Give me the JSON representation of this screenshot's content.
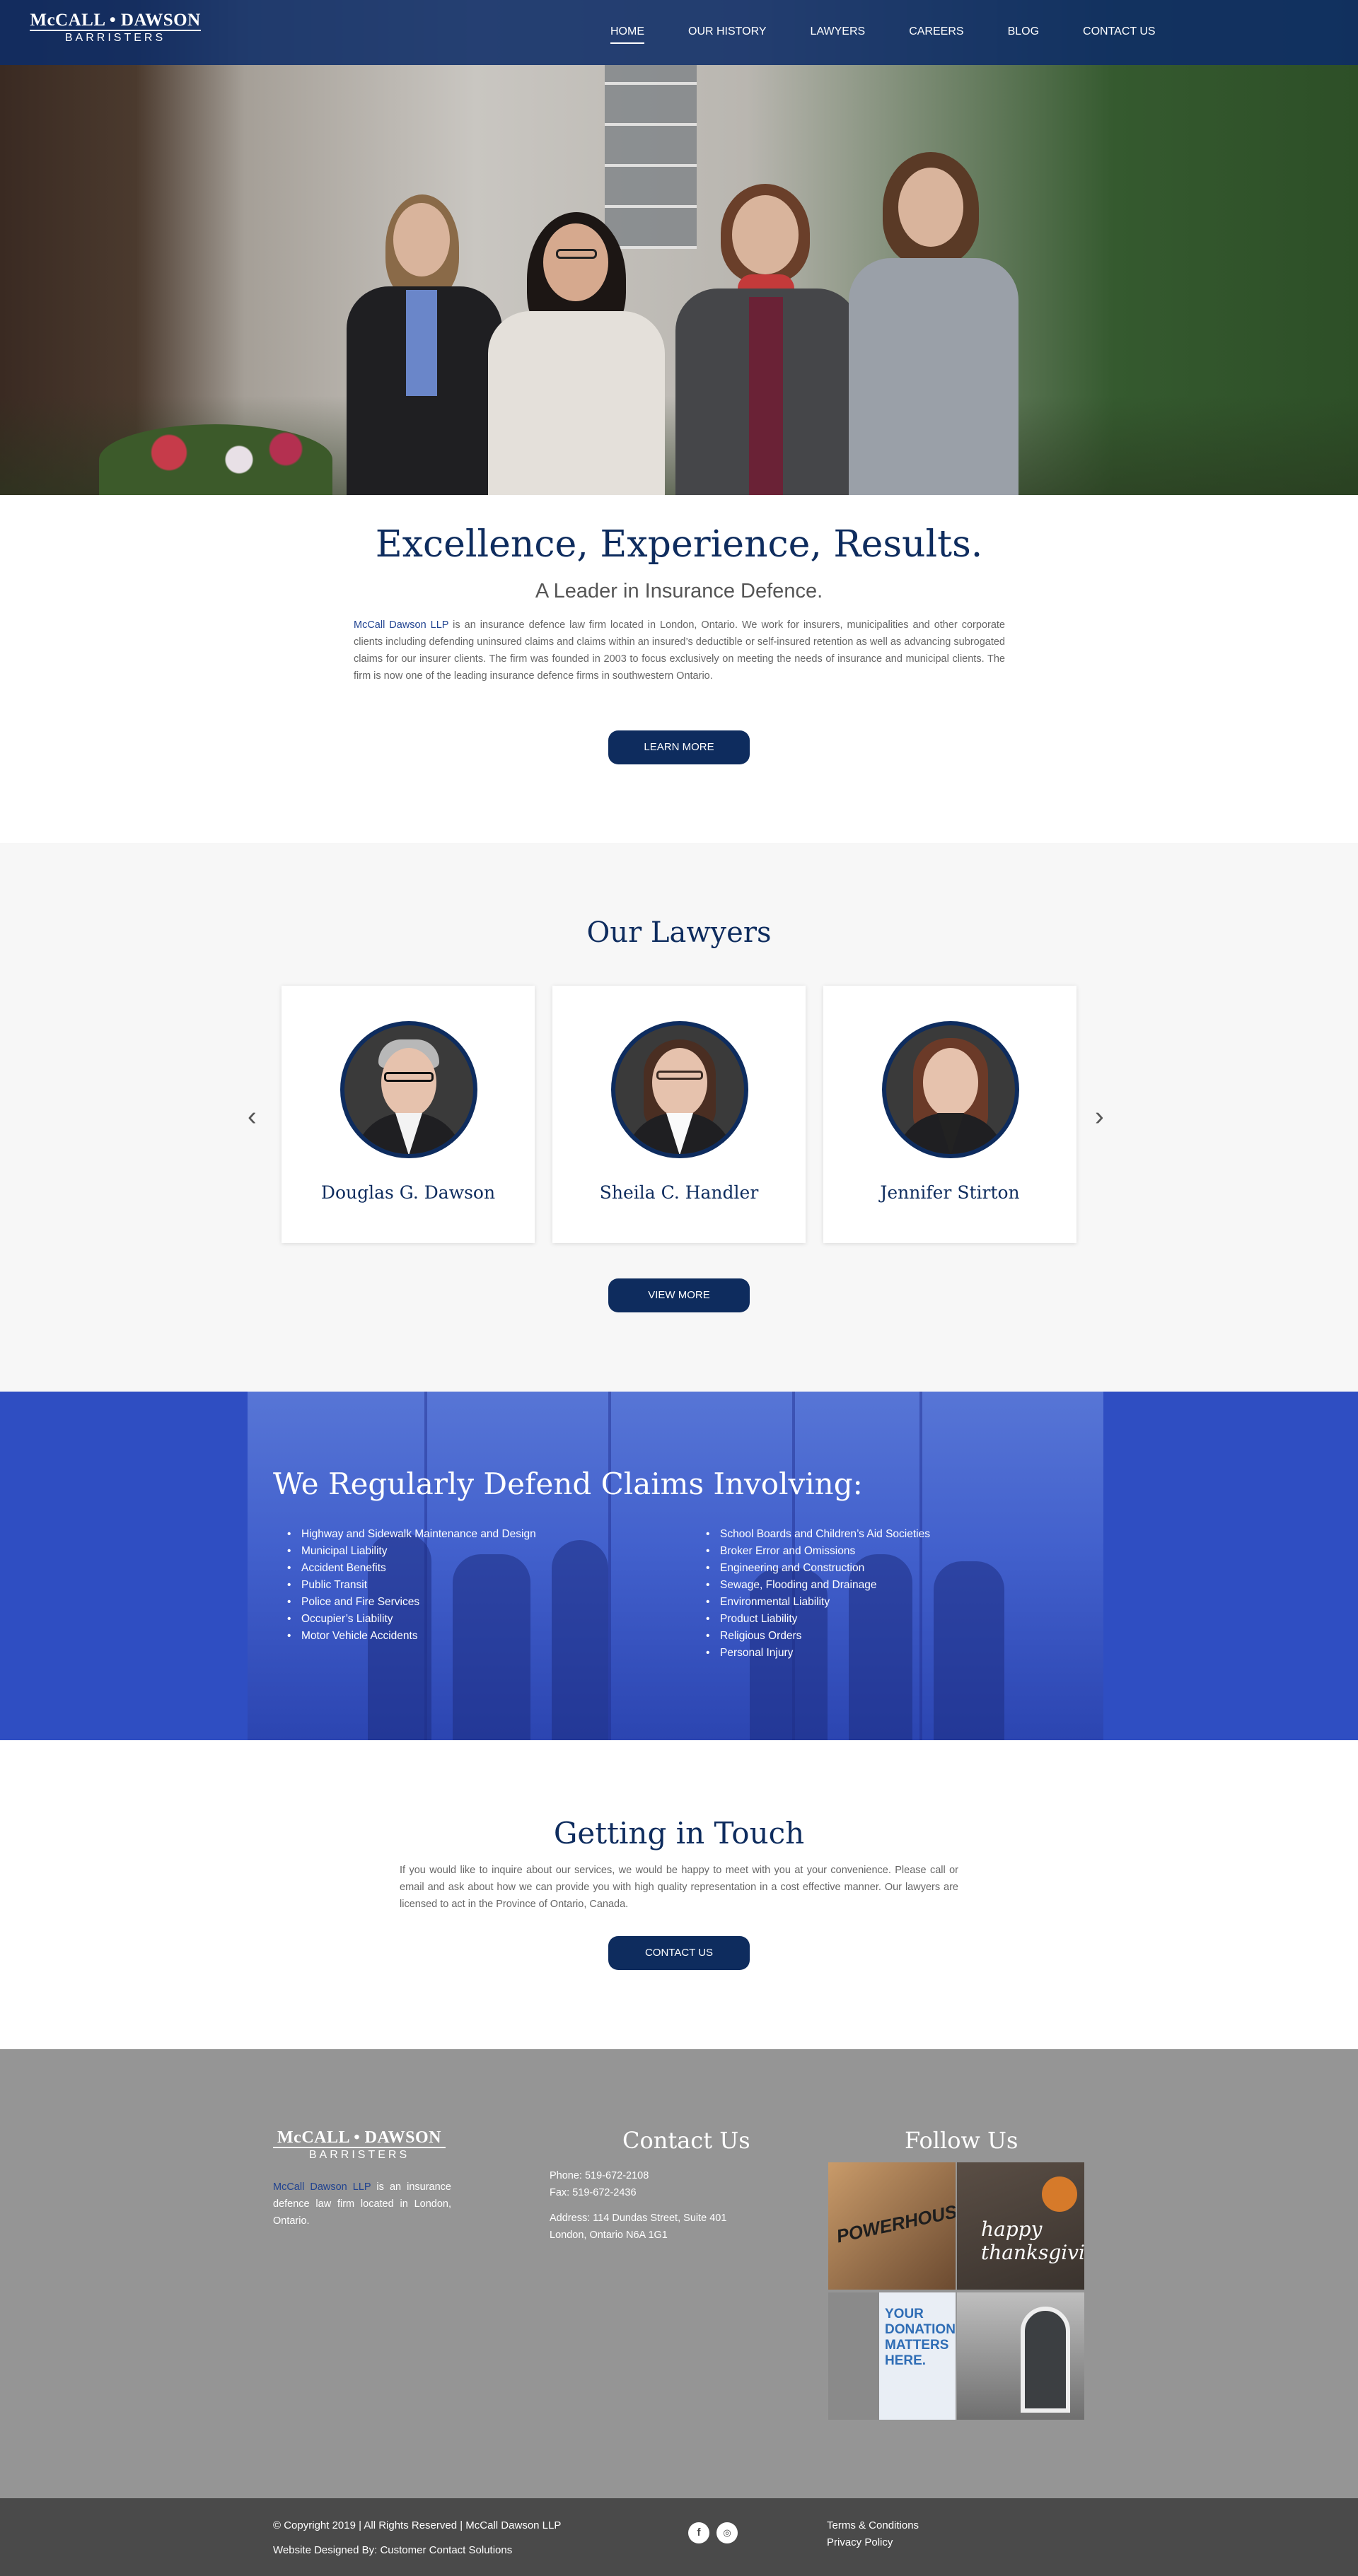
{
  "brand": {
    "name": "McCALL • DAWSON",
    "llp": "LLP",
    "tagline": "BARRISTERS"
  },
  "nav": {
    "items": [
      "HOME",
      "OUR HISTORY",
      "LAWYERS",
      "CAREERS",
      "BLOG",
      "CONTACT US"
    ],
    "active": "HOME"
  },
  "intro": {
    "title": "Excellence, Experience, Results.",
    "subtitle": "A Leader in Insurance Defence.",
    "firm_name": "McCall Dawson LLP",
    "body": " is an insurance defence law firm located in London, Ontario. We work for insurers, municipalities and other corporate clients including defending uninsured claims and claims within an insured’s deductible or self-insured retention as well as advancing subrogated claims for our insurer clients.  The firm was founded in 2003 to focus exclusively on meeting the needs of insurance and municipal clients. The firm is now one of the leading insurance defence firms in southwestern Ontario.",
    "button": "LEARN MORE"
  },
  "lawyers": {
    "title": "Our Lawyers",
    "cards": [
      {
        "name": "Douglas G. Dawson"
      },
      {
        "name": "Sheila C. Handler"
      },
      {
        "name": "Jennifer Stirton"
      }
    ],
    "prev_icon": "chevron-left-icon",
    "next_icon": "chevron-right-icon",
    "button": "VIEW MORE"
  },
  "claims": {
    "title": "We Regularly Defend Claims Involving:",
    "left": [
      "Highway and Sidewalk Maintenance and Design",
      "Municipal Liability",
      "Accident Benefits",
      "Public Transit",
      "Police and Fire Services",
      "Occupier’s Liability",
      "Motor Vehicle Accidents"
    ],
    "right": [
      "School Boards and Children’s Aid Societies",
      "Broker Error and Omissions",
      "Engineering and Construction",
      "Sewage, Flooding and Drainage",
      "Environmental Liability",
      "Product Liability",
      "Religious Orders",
      "Personal Injury"
    ]
  },
  "touch": {
    "title": "Getting in Touch",
    "body": "If you would like to inquire about our services, we would be happy to meet with you at your convenience. Please call or email and ask about how we can provide you with high quality representation in a cost effective manner. Our lawyers are licensed to act in the Province of Ontario, Canada.",
    "button": "CONTACT US"
  },
  "footer": {
    "about_firm": "McCall Dawson LLP",
    "about_text": " is an insurance defence law firm located in London, Ontario.",
    "contact_title": "Contact Us",
    "phone": "Phone: 519-672-2108",
    "fax": "Fax: 519-672-2436",
    "address1": "Address: 114 Dundas Street, Suite 401",
    "address2": "London, Ontario N6A 1G1",
    "follow_title": "Follow Us",
    "instagram": [
      {
        "text": "POWERHOUSE",
        "color": "#7b5a3c"
      },
      {
        "text": "happy thanksgiving",
        "color": "#4a3f37"
      },
      {
        "text": "YOUR DONATION MATTERS HERE.",
        "color": "#2f6db5"
      },
      {
        "text": "",
        "color": "#3c3f42"
      }
    ],
    "copyright": "© Copyright 2019 | All Rights Reserved | McCall Dawson LLP",
    "designed_by": "Website Designed By: Customer Contact Solutions",
    "terms": "Terms & Conditions",
    "privacy": "Privacy Policy",
    "social": [
      "facebook-icon",
      "instagram-icon"
    ]
  },
  "colors": {
    "navy": "#0e2c5e",
    "claims_blue": "#2f4ec2",
    "footer_grey": "#959595",
    "bottom_bar": "#4a4a4a"
  }
}
